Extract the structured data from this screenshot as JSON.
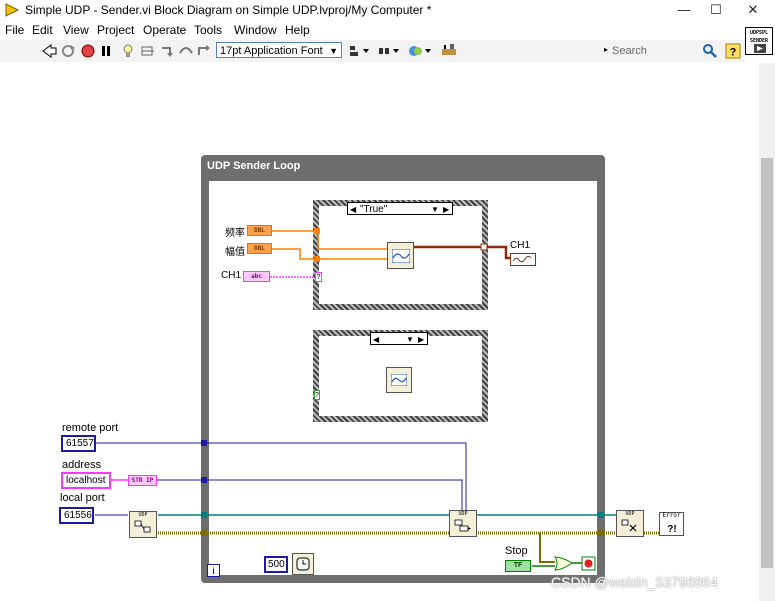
{
  "window": {
    "title": "Simple UDP - Sender.vi Block Diagram on Simple UDP.lvproj/My Computer *",
    "minimize": "—",
    "maximize": "☐",
    "close": "✕"
  },
  "menu": {
    "items": [
      "File",
      "Edit",
      "View",
      "Project",
      "Operate",
      "Tools",
      "Window",
      "Help"
    ]
  },
  "toolbar": {
    "font": "17pt Application Font",
    "search_placeholder": "Search"
  },
  "vi_icon": {
    "line1": "UDPSPL",
    "line2": "SENDER"
  },
  "loop": {
    "title": "UDP Sender Loop",
    "info_label": "i",
    "wait_value": "500",
    "stop_label": "Stop",
    "stop_terminal": "TF"
  },
  "case_true": {
    "selector": "\"True\"",
    "freq_label": "频率",
    "amp_label": "幅值",
    "ch1_in_label": "CH1",
    "dbl": "DBL",
    "abc": "abc",
    "ch1_out_label": "CH1",
    "question": "?"
  },
  "case_false": {
    "selector": "",
    "question": "?"
  },
  "controls": {
    "remote_port_label": "remote port",
    "remote_port_value": "61557",
    "address_label": "address",
    "address_value": "localhost",
    "str_ip": "STR IP",
    "local_port_label": "local port",
    "local_port_value": "61556"
  },
  "nodes": {
    "open": "UDP",
    "write": "UDP",
    "close": "UDP",
    "error": "Error"
  },
  "watermark": "CSDN @weixin_53796864",
  "colors": {
    "loop_frame": "#6e6e6e",
    "dbl_wire": "#ff8000",
    "string_wire": "#ff33ff",
    "int_wire": "#1a1aa6",
    "error_wire": "#7a6a00",
    "waveform_wire": "#8b2b10",
    "refnum_wire": "#008080",
    "bool_wire": "#008000"
  }
}
